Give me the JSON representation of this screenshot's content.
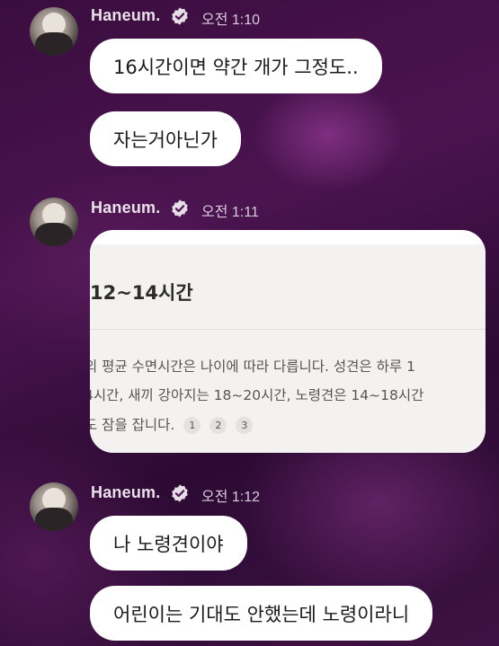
{
  "messages": [
    {
      "sender": "Haneum.",
      "time": "오전 1:10",
      "texts": [
        "16시간이면 약간 개가 그정도..",
        "자는거아닌가"
      ]
    },
    {
      "sender": "Haneum.",
      "time": "오전 1:11",
      "card": {
        "title": "12~14시간",
        "lines": [
          "의 평균 수면시간은 나이에 따라 다릅니다. 성견은 하루 1",
          "4시간, 새끼 강아지는 18~20시간, 노령견은 14~18시간",
          "도 잠을 잡니다."
        ],
        "citations": [
          "1",
          "2",
          "3"
        ]
      }
    },
    {
      "sender": "Haneum.",
      "time": "오전 1:12",
      "texts": [
        "나 노령견이야",
        "어린이는 기대도 안했는데 노령이라니"
      ]
    }
  ],
  "icons": {
    "avatar": "profile-photo",
    "badge": "verified-badge-icon"
  },
  "colors": {
    "bubble": "#ffffff",
    "name": "#e9e0ea",
    "time": "#d8cbdb"
  }
}
